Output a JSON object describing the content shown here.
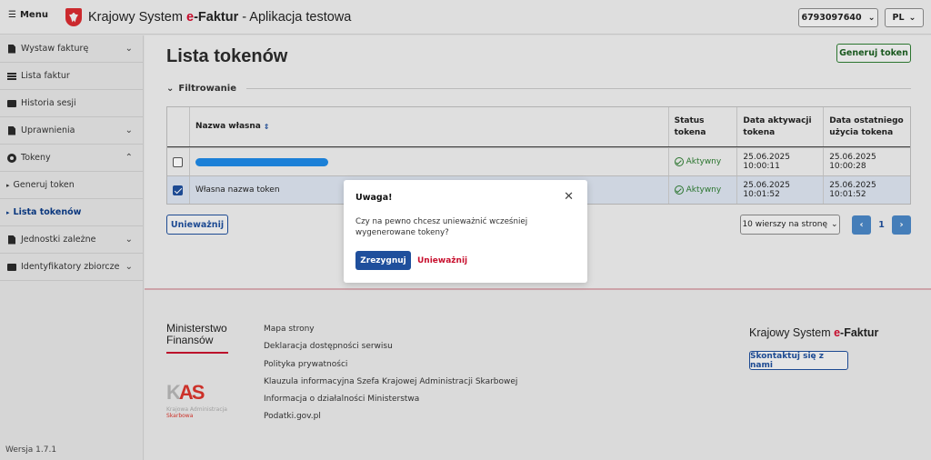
{
  "header": {
    "menu_label": "Menu",
    "title_prefix": "Krajowy System ",
    "title_e": "e",
    "title_faktur": "-Faktur",
    "title_suffix": " - Aplikacja testowa",
    "nip_value": "6793097640",
    "lang_value": "PL"
  },
  "sidebar": {
    "items": [
      {
        "label": "Wystaw fakturę",
        "icon": "document-icon"
      },
      {
        "label": "Lista faktur",
        "icon": "list-icon"
      },
      {
        "label": "Historia sesji",
        "icon": "mail-icon"
      },
      {
        "label": "Uprawnienia",
        "icon": "document-icon"
      },
      {
        "label": "Tokeny",
        "icon": "token-icon"
      },
      {
        "label": "Generuj token"
      },
      {
        "label": "Lista tokenów"
      },
      {
        "label": "Jednostki zależne",
        "icon": "document-icon"
      },
      {
        "label": "Identyfikatory zbiorcze",
        "icon": "group-icon"
      }
    ],
    "version": "Wersja 1.7.1"
  },
  "main": {
    "title": "Lista tokenów",
    "generate_button": "Generuj token",
    "filter_label": "Filtrowanie",
    "columns": {
      "name": "Nazwa własna",
      "status": "Status tokena",
      "activation": "Data aktywacji tokena",
      "last_used": "Data ostatniego użycia tokena"
    },
    "rows": [
      {
        "name": "",
        "status": "Aktywny",
        "activation": "25.06.2025 10:00:11",
        "last_used": "25.06.2025 10:00:28",
        "checked": false
      },
      {
        "name": "Własna nazwa token",
        "status": "Aktywny",
        "activation": "25.06.2025 10:01:52",
        "last_used": "25.06.2025 10:01:52",
        "checked": true
      }
    ],
    "invalidate_button": "Unieważnij",
    "per_page": "10 wierszy na stronę",
    "page_number": "1"
  },
  "footer": {
    "ministry_line1": "Ministerstwo",
    "ministry_line2": "Finansów",
    "kas_mark_left": "K",
    "kas_mark_right": "AS",
    "kas_line1": "Krajowa Administracja",
    "kas_line2": "Skarbowa",
    "links": [
      "Mapa strony",
      "Deklaracja dostępności serwisu",
      "Polityka prywatności",
      "Klauzula informacyjna Szefa Krajowej Administracji Skarbowej",
      "Informacja o działalności Ministerstwa",
      "Podatki.gov.pl"
    ],
    "brand_prefix": "Krajowy System ",
    "brand_e": "e",
    "brand_faktur": "-Faktur",
    "contact_button": "Skontaktuj się z nami"
  },
  "modal": {
    "title": "Uwaga!",
    "message": "Czy na pewno chcesz unieważnić wcześniej wygenerowane tokeny?",
    "cancel": "Zrezygnuj",
    "confirm": "Unieważnij"
  },
  "colors": {
    "brand_red": "#d20b2d",
    "primary_blue": "#1f4f9c",
    "success_green": "#2e7d32"
  }
}
